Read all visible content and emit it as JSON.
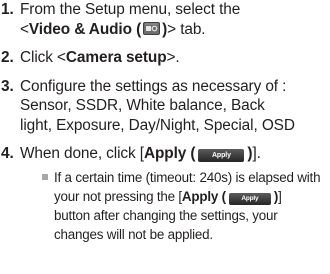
{
  "steps": [
    {
      "number": "1.",
      "line1": "From the Setup menu, select the",
      "open": "<",
      "tab_label": "Video & Audio (",
      "tab_close": ")",
      "close": "> tab.",
      "icon": "video-audio-icon"
    },
    {
      "number": "2.",
      "prefix": "Click <",
      "bold": "Camera setup",
      "suffix": ">."
    },
    {
      "number": "3.",
      "line1": "Configure the settings as necessary of :",
      "line2": "Sensor, SSDR, White balance, Back",
      "line3": "light, Exposure, Day/Night, Special, OSD"
    },
    {
      "number": "4.",
      "prefix": "When done, click [",
      "bold": "Apply (",
      "button_label": "Apply",
      "bold_close": ")",
      "suffix": "]."
    }
  ],
  "note": {
    "part1": "If a certain time (timeout: 240s) is elapsed with",
    "part2a": "your not pressing the [",
    "bold": "Apply (",
    "button_label": "Apply",
    "bold_close": ")",
    "part2b": "]",
    "part3": "button after changing the settings, your",
    "part4": "changes will not be applied."
  }
}
